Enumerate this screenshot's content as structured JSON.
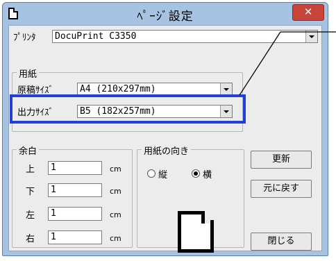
{
  "window": {
    "title": "ﾍﾟｰｼﾞ設定",
    "close_label": "✕"
  },
  "printer": {
    "label": "ﾌﾟﾘﾝﾀ",
    "value": "DocuPrint C3350"
  },
  "paper": {
    "group_label": "用紙",
    "original_label": "原稿ｻｲｽﾞ",
    "original_value": "A4 (210x297mm)",
    "output_label": "出力ｻｲｽﾞ",
    "output_value": "B5 (182x257mm)"
  },
  "margins": {
    "group_label": "余白",
    "unit": "cm",
    "rows": [
      {
        "label": "上",
        "value": "1"
      },
      {
        "label": "下",
        "value": "1"
      },
      {
        "label": "左",
        "value": "1"
      },
      {
        "label": "右",
        "value": "1"
      }
    ]
  },
  "orientation": {
    "group_label": "用紙の向き",
    "portrait_label": "縦",
    "landscape_label": "横",
    "selected": "横"
  },
  "buttons": {
    "update": "更新",
    "restore": "元に戻す",
    "close": "閉じる"
  },
  "colors": {
    "highlight": "#2140d8",
    "titlebar": "#a7c3e2",
    "close_button": "#c7453a"
  }
}
